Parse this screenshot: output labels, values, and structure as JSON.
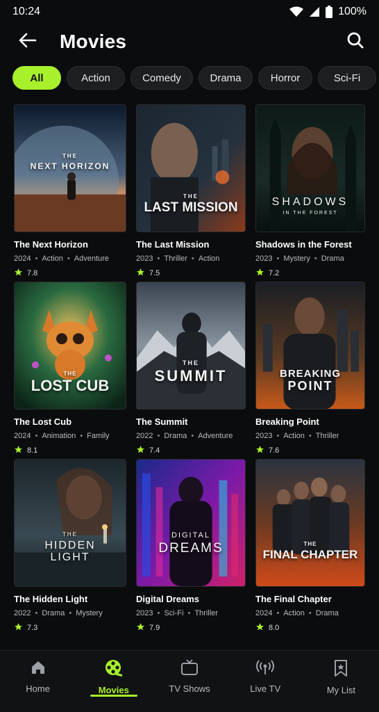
{
  "status": {
    "time": "10:24",
    "battery": "100%"
  },
  "header": {
    "title": "Movies"
  },
  "chips": [
    {
      "label": "All",
      "active": true
    },
    {
      "label": "Action"
    },
    {
      "label": "Comedy"
    },
    {
      "label": "Drama"
    },
    {
      "label": "Horror"
    },
    {
      "label": "Sci-Fi"
    }
  ],
  "movies": [
    {
      "title": "The Next Horizon",
      "year": "2024",
      "genre1": "Action",
      "genre2": "Adventure",
      "rating": "7.8",
      "poster_line1": "THE",
      "poster_line2": "NEXT HORIZON"
    },
    {
      "title": "The Last Mission",
      "year": "2023",
      "genre1": "Thriller",
      "genre2": "Action",
      "rating": "7.5",
      "poster_line1": "THE",
      "poster_line2": "LAST MISSION"
    },
    {
      "title": "Shadows in the Forest",
      "year": "2023",
      "genre1": "Mystery",
      "genre2": "Drama",
      "rating": "7.2",
      "poster_line1": "SHADOWS",
      "poster_line2": "IN THE FOREST"
    },
    {
      "title": "The Lost Cub",
      "year": "2024",
      "genre1": "Animation",
      "genre2": "Family",
      "rating": "8.1",
      "poster_line1": "THE",
      "poster_line2": "LOST CUB"
    },
    {
      "title": "The Summit",
      "year": "2022",
      "genre1": "Drama",
      "genre2": "Adventure",
      "rating": "7.4",
      "poster_line1": "THE",
      "poster_line2": "SUMMIT"
    },
    {
      "title": "Breaking Point",
      "year": "2023",
      "genre1": "Action",
      "genre2": "Thriller",
      "rating": "7.6",
      "poster_line1": "BREAKING",
      "poster_line2": "POINT"
    },
    {
      "title": "The Hidden Light",
      "year": "2022",
      "genre1": "Drama",
      "genre2": "Mystery",
      "rating": "7.3",
      "poster_line1": "THE",
      "poster_line2": "HIDDEN LIGHT"
    },
    {
      "title": "Digital Dreams",
      "year": "2023",
      "genre1": "Sci-Fi",
      "genre2": "Thriller",
      "rating": "7.9",
      "poster_line1": "DIGITAL",
      "poster_line2": "DREAMS"
    },
    {
      "title": "The Final Chapter",
      "year": "2024",
      "genre1": "Action",
      "genre2": "Drama",
      "rating": "8.0",
      "poster_line1": "THE",
      "poster_line2": "FINAL CHAPTER"
    }
  ],
  "nav": [
    {
      "label": "Home",
      "icon": "home-icon"
    },
    {
      "label": "Movies",
      "icon": "film-reel-icon",
      "active": true
    },
    {
      "label": "TV Shows",
      "icon": "tv-icon"
    },
    {
      "label": "Live TV",
      "icon": "broadcast-icon"
    },
    {
      "label": "My List",
      "icon": "bookmark-icon"
    }
  ],
  "colors": {
    "accent": "#a8f02c",
    "background": "#0b0c0d",
    "star": "#a8f02c"
  }
}
